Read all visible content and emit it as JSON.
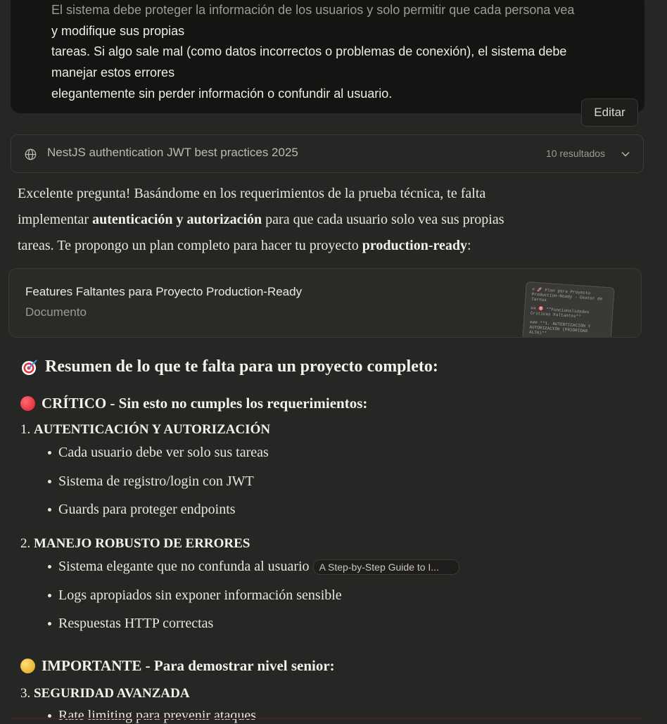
{
  "user_message": {
    "lines": [
      "El sistema debe proteger la información de los usuarios y solo permitir que cada persona vea",
      "y modifique sus propias",
      "tareas. Si algo sale mal (como datos incorrectos o problemas de conexión), el sistema debe",
      "manejar estos errores",
      "elegantemente sin perder información o confundir al usuario."
    ],
    "edit_label": "Editar"
  },
  "search": {
    "icon": "globe-icon",
    "query": "NestJS authentication JWT best practices 2025",
    "results": "10 resultados"
  },
  "intro": {
    "p1": "Excelente pregunta! Basándome en los requerimientos de la prueba técnica, te falta",
    "p2a": "implementar ",
    "p2b": "autenticación y autorización",
    "p2c": " para que cada usuario solo vea sus propias",
    "p3a": "tareas. Te propongo un plan completo para hacer tu proyecto ",
    "p3b": "production-ready",
    "p3c": ":"
  },
  "artifact": {
    "title": "Features Faltantes para Proyecto Production-Ready",
    "type": "Documento",
    "thumb_lines": [
      "# 🚀 Plan para Proyecto Production-Ready - Gestor de Tareas",
      "## 🎯 **Funcionalidades Críticas Faltantes**",
      "### **1. AUTENTICACIÓN Y AUTORIZACIÓN (PRIORIDAD ALTA)**"
    ]
  },
  "summary": {
    "heading": "Resumen de lo que te falta para un proyecto completo:",
    "critical": {
      "heading": "CRÍTICO - Sin esto no cumples los requerimientos:",
      "item1": {
        "number": "1.",
        "title": "AUTENTICACIÓN Y AUTORIZACIÓN",
        "bullets": [
          "Cada usuario debe ver solo sus tareas",
          "Sistema de registro/login con JWT",
          "Guards para proteger endpoints"
        ]
      },
      "item2": {
        "number": "2.",
        "title": "MANEJO ROBUSTO DE ERRORES",
        "bullets": [
          "Sistema elegante que no confunda al usuario",
          "Logs apropiados sin exponer información sensible",
          "Respuestas HTTP correctas"
        ],
        "citation": "A Step-by-Step Guide to I..."
      }
    },
    "important": {
      "heading": "IMPORTANTE - Para demostrar nivel senior:",
      "item3": {
        "number": "3.",
        "title": "SEGURIDAD AVANZADA",
        "bullets": [
          "Rate limiting para prevenir ataques"
        ]
      }
    }
  },
  "colors": {
    "background": "#262624",
    "user_bubble": "#141413",
    "critical_dot": "#e8404a",
    "important_dot": "#f0b429"
  }
}
